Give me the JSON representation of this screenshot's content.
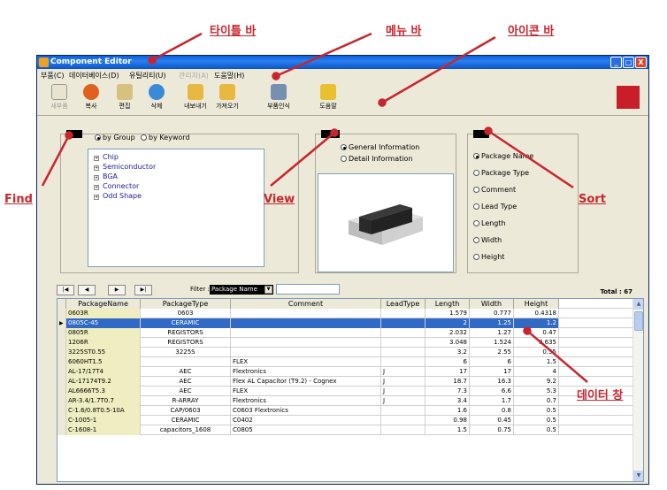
{
  "annotations": {
    "titlebar": "타이틀 바",
    "menubar": "메뉴 바",
    "iconbar": "아이콘 바",
    "find": "Find",
    "view": "View",
    "sort": "Sort",
    "datawindow": "데이터 창"
  },
  "window": {
    "title": "Component Editor",
    "controls": [
      "_",
      "□",
      "X"
    ]
  },
  "menu": [
    "부품(C)",
    "데이터베이스(D)",
    "유틸리티(U)",
    "관리자(A)",
    "도움말(H)"
  ],
  "toolbar": [
    {
      "label": "새부품",
      "icon": "new-part-icon"
    },
    {
      "label": "복사",
      "icon": "copy-icon"
    },
    {
      "label": "편집",
      "icon": "edit-icon"
    },
    {
      "label": "삭제",
      "icon": "delete-icon"
    },
    {
      "label": "내보내기",
      "icon": "export-icon"
    },
    {
      "label": "가져오기",
      "icon": "import-icon"
    },
    {
      "label": "부품인식",
      "icon": "part-recognition-icon"
    },
    {
      "label": "도움말",
      "icon": "help-icon"
    }
  ],
  "find": {
    "label": "Find",
    "options": [
      "by Group",
      "by Keyword"
    ],
    "selected": "by Group",
    "tree": [
      "Chip",
      "Semiconductor",
      "BGA",
      "Connector",
      "Odd Shape"
    ]
  },
  "view": {
    "label": "View",
    "options": [
      "General Information",
      "Detail Information"
    ],
    "selected": "General Information"
  },
  "sort": {
    "label": "Sort",
    "options": [
      "Package Name",
      "Package Type",
      "Comment",
      "Lead Type",
      "Length",
      "Width",
      "Height"
    ],
    "selected": "Package Name"
  },
  "nav": {
    "buttons": [
      "|◀",
      "◀",
      "▶",
      "▶|"
    ],
    "filter_label": "Filter :",
    "filter_value": "Package Name",
    "total": "Total : 67"
  },
  "grid": {
    "columns": [
      "PackageName",
      "PackageType",
      "Comment",
      "LeadType",
      "Length",
      "Width",
      "Height"
    ],
    "selected_row": 1,
    "rows": [
      [
        "0603R",
        "0603",
        "",
        "",
        "1.579",
        "0.777",
        "0.4318"
      ],
      [
        "0805C-45",
        "CERAMIC",
        "",
        "",
        "2",
        "1.25",
        "1.2"
      ],
      [
        "0805R",
        "REGISTORS",
        "",
        "",
        "2.032",
        "1.27",
        "0.47"
      ],
      [
        "1206R",
        "REGISTORS",
        "",
        "",
        "3.048",
        "1.524",
        "0.635"
      ],
      [
        "3225ST0.55",
        "3225S",
        "",
        "",
        "3.2",
        "2.55",
        "0.55"
      ],
      [
        "6060HT1.5",
        "",
        "FLEX",
        "",
        "6",
        "6",
        "1.5"
      ],
      [
        "AL-17/17T4",
        "AEC",
        "Flextronics",
        "J",
        "17",
        "17",
        "4"
      ],
      [
        "AL-17174T9.2",
        "AEC",
        "Flex AL Capacitor (T9.2) - Cognex",
        "J",
        "18.7",
        "16.3",
        "9.2"
      ],
      [
        "AL6666T5.3",
        "AEC",
        "FLEX",
        "J",
        "7.3",
        "6.6",
        "5.3"
      ],
      [
        "AR-3.4/1.7T0.7",
        "R-ARRAY",
        "Flextronics",
        "J",
        "3.4",
        "1.7",
        "0.7"
      ],
      [
        "C-1.6/0.8T0.5-10A",
        "CAP/0603",
        "C0603 Flextronics",
        "",
        "1.6",
        "0.8",
        "0.5"
      ],
      [
        "C-1005-1",
        "CERAMIC",
        "C0402",
        "",
        "0.98",
        "0.45",
        "0.5"
      ],
      [
        "C-1608-1",
        "capacitors_1608",
        "C0805",
        "",
        "1.5",
        "0.75",
        "0.5"
      ]
    ]
  }
}
